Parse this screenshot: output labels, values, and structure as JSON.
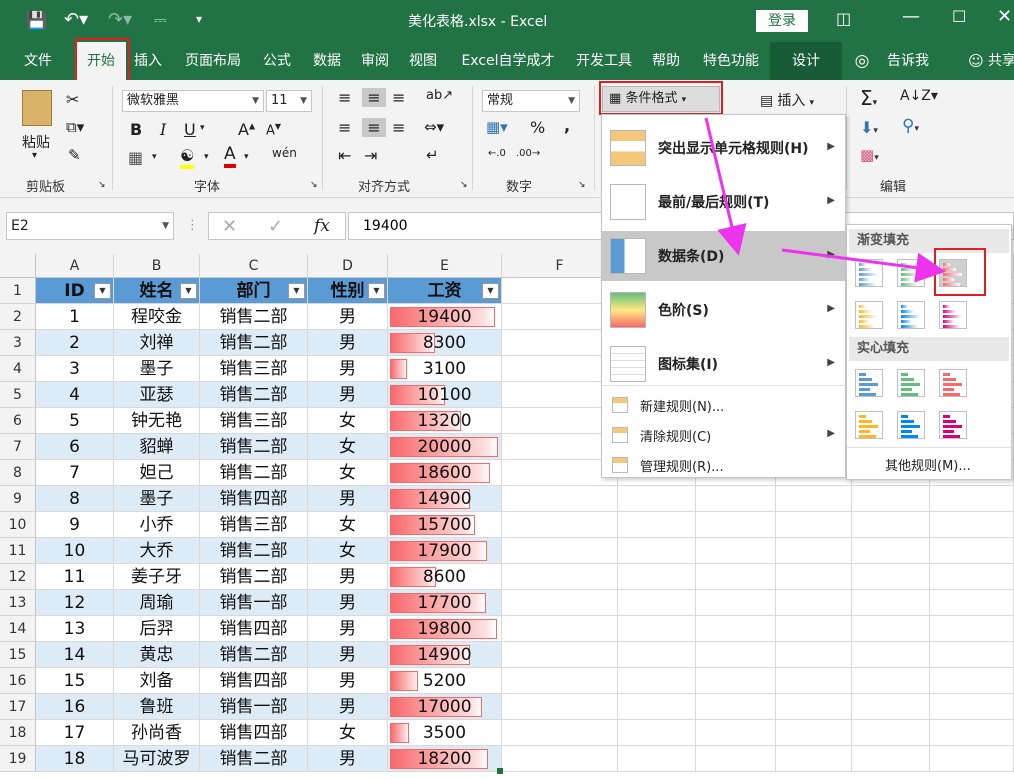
{
  "window": {
    "title": "美化表格.xlsx  -  Excel",
    "login_label": "登录"
  },
  "tabs": [
    "文件",
    "开始",
    "插入",
    "页面布局",
    "公式",
    "数据",
    "审阅",
    "视图",
    "Excel自学成才",
    "开发工具",
    "帮助",
    "特色功能",
    "设计"
  ],
  "tell_me": "告诉我",
  "share": "共享",
  "ribbon": {
    "paste": "粘贴",
    "clipboard_group": "剪贴板",
    "font_name": "微软雅黑",
    "font_size": "11",
    "font_group": "字体",
    "align_group": "对齐方式",
    "number_format": "常规",
    "number_group": "数字",
    "cond_format": "条件格式",
    "insert": "插入",
    "edit_group": "编辑"
  },
  "formula_bar": {
    "name_box": "E2",
    "fx": "fx",
    "value": "19400"
  },
  "columns": [
    "A",
    "B",
    "C",
    "D",
    "E",
    "F"
  ],
  "headers": [
    "ID",
    "姓名",
    "部门",
    "性别",
    "工资"
  ],
  "rows": [
    [
      "1",
      "程咬金",
      "销售二部",
      "男",
      "19400"
    ],
    [
      "2",
      "刘禅",
      "销售二部",
      "男",
      "8300"
    ],
    [
      "3",
      "墨子",
      "销售三部",
      "男",
      "3100"
    ],
    [
      "4",
      "亚瑟",
      "销售二部",
      "男",
      "10100"
    ],
    [
      "5",
      "钟无艳",
      "销售三部",
      "女",
      "13200"
    ],
    [
      "6",
      "貂蝉",
      "销售二部",
      "女",
      "20000"
    ],
    [
      "7",
      "妲己",
      "销售二部",
      "女",
      "18600"
    ],
    [
      "8",
      "墨子",
      "销售四部",
      "男",
      "14900"
    ],
    [
      "9",
      "小乔",
      "销售三部",
      "女",
      "15700"
    ],
    [
      "10",
      "大乔",
      "销售二部",
      "女",
      "17900"
    ],
    [
      "11",
      "姜子牙",
      "销售二部",
      "男",
      "8600"
    ],
    [
      "12",
      "周瑜",
      "销售一部",
      "男",
      "17700"
    ],
    [
      "13",
      "后羿",
      "销售四部",
      "男",
      "19800"
    ],
    [
      "14",
      "黄忠",
      "销售二部",
      "男",
      "14900"
    ],
    [
      "15",
      "刘备",
      "销售四部",
      "男",
      "5200"
    ],
    [
      "16",
      "鲁班",
      "销售一部",
      "男",
      "17000"
    ],
    [
      "17",
      "孙尚香",
      "销售四部",
      "女",
      "3500"
    ],
    [
      "18",
      "马可波罗",
      "销售二部",
      "男",
      "18200"
    ]
  ],
  "salary_max": 20000,
  "cf_menu": {
    "items": [
      {
        "label": "突出显示单元格规则(H)",
        "icon": "highlight-rules-icon"
      },
      {
        "label": "最前/最后规则(T)",
        "icon": "top-bottom-rules-icon"
      },
      {
        "label": "数据条(D)",
        "icon": "data-bars-icon"
      },
      {
        "label": "色阶(S)",
        "icon": "color-scales-icon"
      },
      {
        "label": "图标集(I)",
        "icon": "icon-sets-icon"
      }
    ],
    "small": [
      {
        "label": "新建规则(N)...",
        "icon": "new-rule-icon"
      },
      {
        "label": "清除规则(C)",
        "icon": "clear-rules-icon"
      },
      {
        "label": "管理规则(R)...",
        "icon": "manage-rules-icon"
      }
    ]
  },
  "databar_menu": {
    "gradient_title": "渐变填充",
    "solid_title": "实心填充",
    "more_rules": "其他规则(M)...",
    "colors": [
      "#5b9bd5",
      "#63be7b",
      "#f8696b",
      "#ffb628",
      "#008aef",
      "#d6007b"
    ]
  },
  "colors": {
    "excel_green": "#217346",
    "header_blue": "#5b9bd5",
    "row_alt": "#ddebf7",
    "bar_red": "#f8696b",
    "highlight_red": "#e02020",
    "arrow_magenta": "#ee33ee"
  }
}
